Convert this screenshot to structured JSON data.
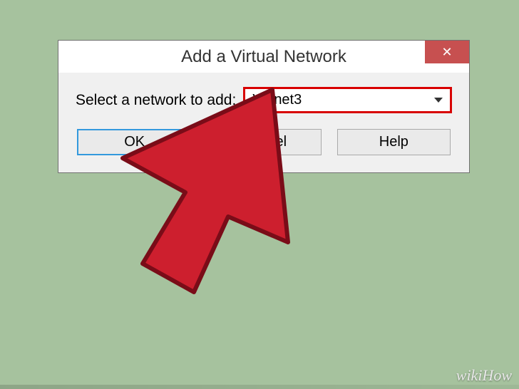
{
  "dialog": {
    "title": "Add a Virtual Network",
    "close": "✕",
    "label": "Select a network to add:",
    "dropdown_value": "VMnet3",
    "buttons": {
      "ok": "OK",
      "cancel": "Cancel",
      "help": "Help"
    }
  },
  "watermark": "wikiHow"
}
